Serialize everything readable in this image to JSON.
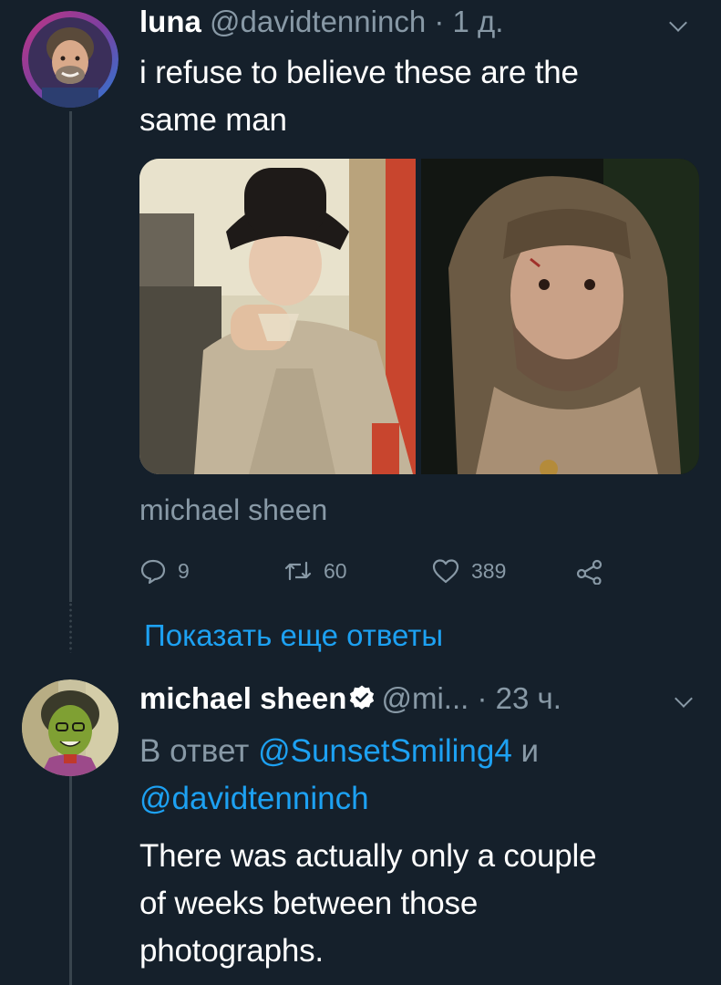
{
  "tweet1": {
    "display_name": "luna",
    "handle": "@davidtenninch",
    "separator": "·",
    "time": "1 д.",
    "text_line1": "i refuse to believe these are the",
    "text_line2": "same man",
    "caption": "michael sheen",
    "replies": "9",
    "retweets": "60",
    "likes": "389"
  },
  "thread": {
    "show_more_label": "Показать еще ответы"
  },
  "tweet2": {
    "display_name": "michael sheen",
    "handle": "@mi...",
    "separator": "·",
    "time": "23 ч.",
    "reply_prefix": "В ответ",
    "reply_to_1": "@SunsetSmiling4",
    "reply_conjunction": "и",
    "reply_to_2": "@davidtenninch",
    "text_line1": "There was actually only a couple",
    "text_line2": "of weeks between those",
    "text_line3": "photographs."
  },
  "icons": {
    "reply": "reply-icon",
    "retweet": "retweet-icon",
    "like": "heart-icon",
    "share": "share-icon",
    "verified": "verified-badge-icon",
    "more": "chevron-down-icon"
  },
  "colors": {
    "background": "#15202b",
    "primary_text": "#ffffff",
    "muted_text": "#8899a6",
    "link": "#1da1f2",
    "thread_line": "#38444d"
  }
}
